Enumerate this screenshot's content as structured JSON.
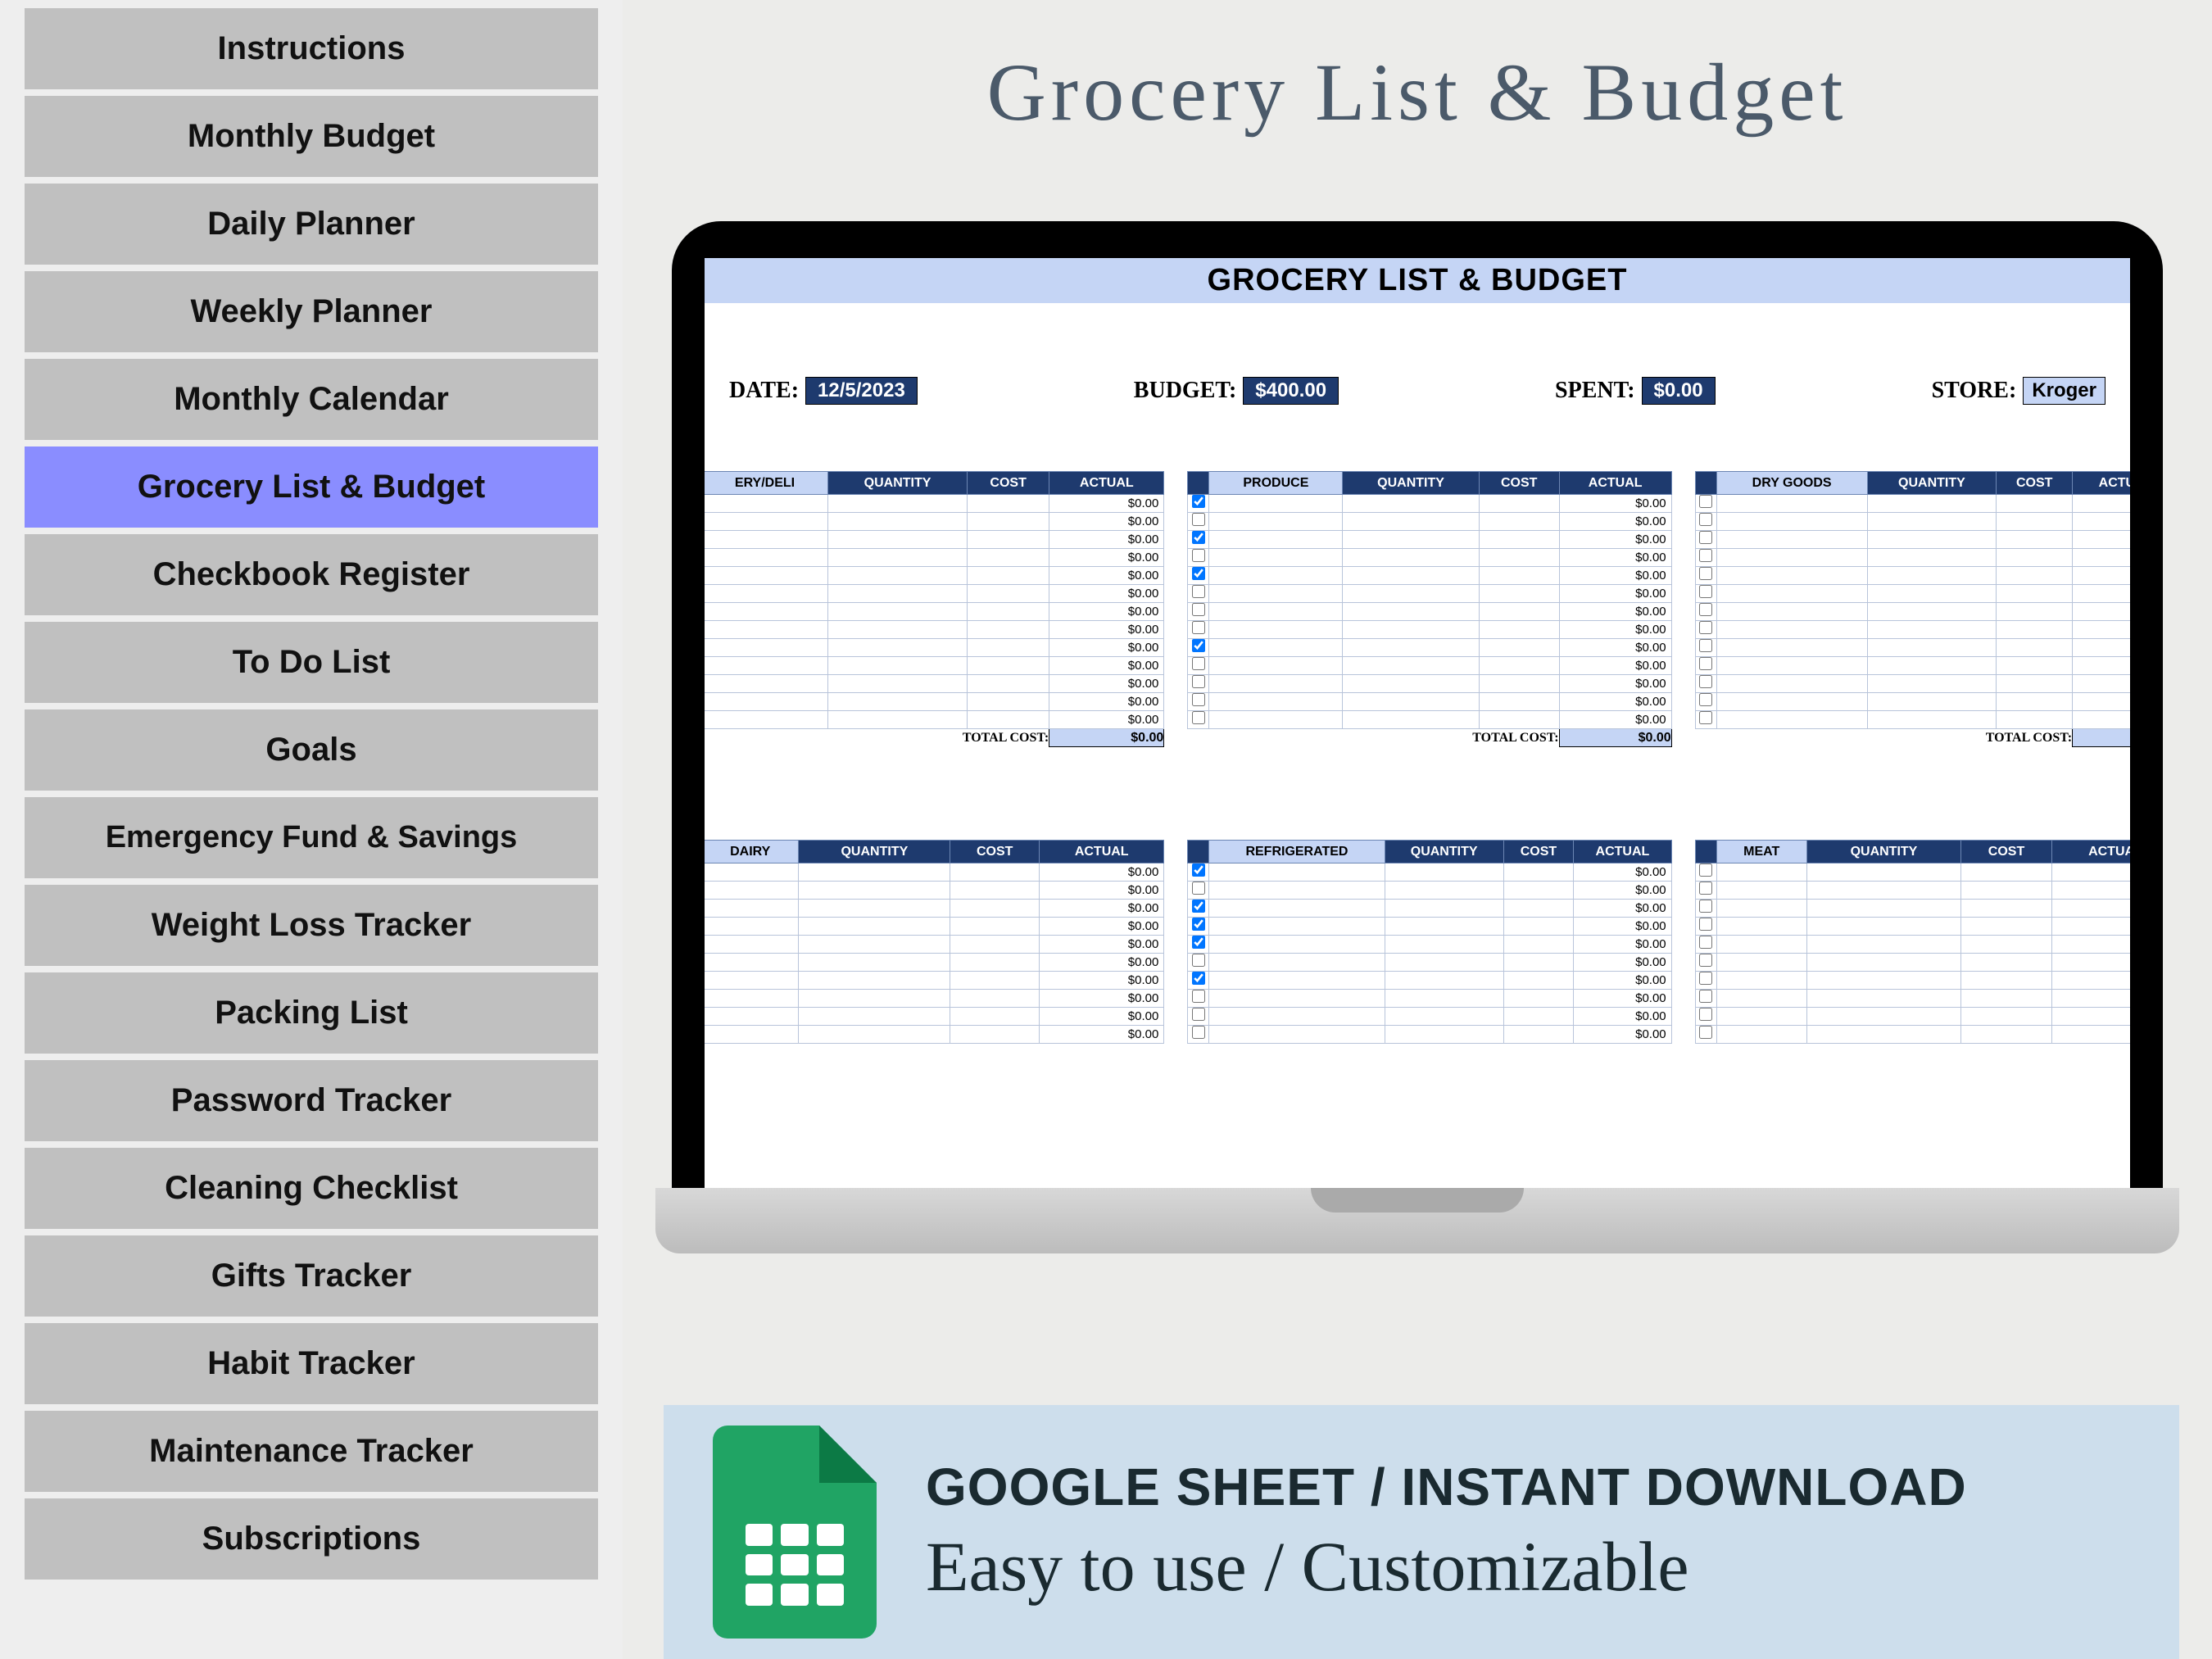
{
  "sidebar": {
    "items": [
      "Instructions",
      "Monthly Budget",
      "Daily Planner",
      "Weekly Planner",
      "Monthly Calendar",
      "Grocery List & Budget",
      "Checkbook Register",
      "To Do List",
      "Goals",
      "Emergency Fund & Savings",
      "Weight Loss Tracker",
      "Packing List",
      "Password Tracker",
      "Cleaning Checklist",
      "Gifts Tracker",
      "Habit Tracker",
      "Maintenance Tracker",
      "Subscriptions"
    ],
    "active_index": 5
  },
  "title": "Grocery List & Budget",
  "sheet": {
    "title": "GROCERY LIST & BUDGET",
    "summary": {
      "date_label": "DATE:",
      "date": "12/5/2023",
      "budget_label": "BUDGET:",
      "budget": "$400.00",
      "spent_label": "SPENT:",
      "spent": "$0.00",
      "store_label": "STORE:",
      "store": "Kroger"
    },
    "col_headers": {
      "quantity": "QUANTITY",
      "cost": "COST",
      "actual": "ACTUAL"
    },
    "row1": [
      {
        "name": "ERY/DELI",
        "rows": 13,
        "checks": [],
        "total_label": "TOTAL COST:",
        "total": "$0.00"
      },
      {
        "name": "PRODUCE",
        "rows": 13,
        "checks": [
          0,
          2,
          4,
          8
        ],
        "total_label": "TOTAL COST:",
        "total": "$0.00"
      },
      {
        "name": "DRY GOODS",
        "rows": 13,
        "checks": [],
        "total_label": "TOTAL COST:",
        "total": ""
      }
    ],
    "row2": [
      {
        "name": "DAIRY",
        "rows": 10,
        "checks": [],
        "total_label": "",
        "total": ""
      },
      {
        "name": "REFRIGERATED",
        "rows": 10,
        "checks": [
          0,
          2,
          3,
          4,
          6
        ],
        "total_label": "",
        "total": ""
      },
      {
        "name": "MEAT",
        "rows": 10,
        "checks": [],
        "total_label": "",
        "total": ""
      }
    ],
    "actual_default": "$0.00"
  },
  "footer": {
    "line1": "GOOGLE SHEET / INSTANT DOWNLOAD",
    "line2": "Easy to use / Customizable"
  }
}
